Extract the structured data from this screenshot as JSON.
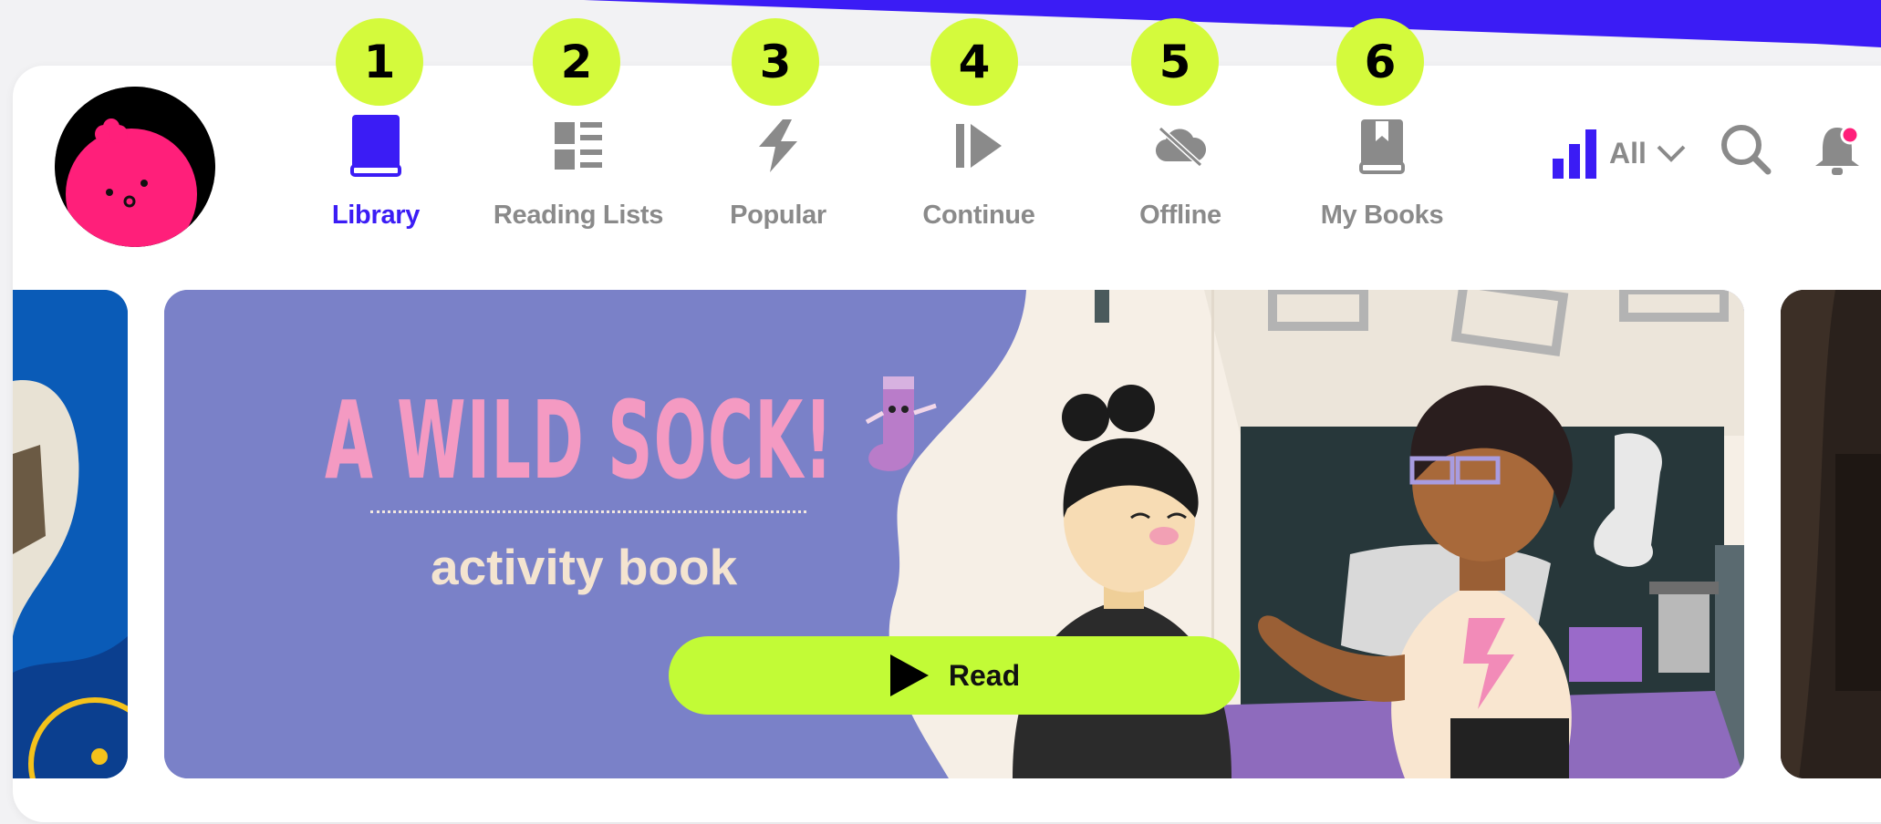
{
  "nav": {
    "items": [
      {
        "badge": "1",
        "label": "Library",
        "icon": "book-icon",
        "active": true
      },
      {
        "badge": "2",
        "label": "Reading Lists",
        "icon": "list-icon",
        "active": false
      },
      {
        "badge": "3",
        "label": "Popular",
        "icon": "lightning-icon",
        "active": false
      },
      {
        "badge": "4",
        "label": "Continue",
        "icon": "resume-play-icon",
        "active": false
      },
      {
        "badge": "5",
        "label": "Offline",
        "icon": "cloud-off-icon",
        "active": false
      },
      {
        "badge": "6",
        "label": "My Books",
        "icon": "bookmark-book-icon",
        "active": false
      }
    ]
  },
  "filter": {
    "label": "All",
    "icon": "level-bars-icon"
  },
  "header_icons": {
    "search": "search-icon",
    "notifications": "bell-icon",
    "notification_dot_color": "#ff1f7a"
  },
  "banner": {
    "title": "A WILD SOCK!",
    "subtitle": "activity book",
    "read_label": "Read"
  },
  "colors": {
    "accent": "#3b1cf5",
    "lime": "#c2fb36",
    "banner_bg": "#7a81c8",
    "title_pink": "#f49ac2",
    "avatar_pink": "#ff1f7a"
  }
}
